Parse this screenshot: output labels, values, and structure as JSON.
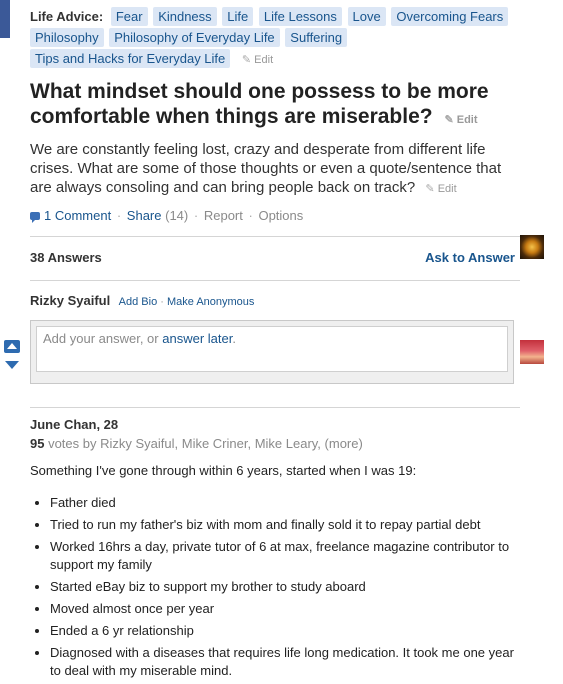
{
  "topics": {
    "label": "Life Advice:",
    "tags": [
      "Fear",
      "Kindness",
      "Life",
      "Life Lessons",
      "Love",
      "Overcoming Fears",
      "Philosophy",
      "Philosophy of Everyday Life",
      "Suffering",
      "Tips and Hacks for Everyday Life"
    ],
    "edit_label": "Edit"
  },
  "question": {
    "title": "What mindset should one possess to be more comfortable when things are miserable?",
    "edit_label": "Edit",
    "details": "We are constantly feeling lost, crazy and desperate from different life crises. What are some of those thoughts or even a quote/sentence that are always consoling and can bring people back on track?",
    "details_edit_label": "Edit"
  },
  "actions": {
    "comment": "1 Comment",
    "share": "Share",
    "share_count": "(14)",
    "report": "Report",
    "options": "Options",
    "separator": "·"
  },
  "answers_bar": {
    "count": "38 Answers",
    "ask": "Ask to Answer"
  },
  "composer": {
    "name": "Rizky Syaiful",
    "add_bio": "Add Bio",
    "make_anonymous": "Make Anonymous",
    "placeholder_prefix": "Add your answer, or ",
    "answer_later": "answer later",
    "placeholder_suffix": "."
  },
  "answer": {
    "author": "June Chan, 28",
    "votes_num": "95",
    "votes_text": " votes by Rizky Syaiful, Mike Criner, Mike Leary, (more)",
    "intro": "Something I've gone through within 6 years, started when I was 19:",
    "items": [
      "Father died",
      "Tried to run my father's biz with mom and finally sold it to repay partial debt",
      "Worked 16hrs a day, private tutor of 6 at max, freelance magazine contributor to support my family",
      "Started eBay biz to support my brother to study aboard",
      "Moved almost once per year",
      "Ended a 6 yr relationship",
      "Diagnosed with a diseases that requires life long medication. It took me one year to deal with my miserable mind."
    ]
  },
  "colors": {
    "link": "#19558d",
    "tag_bg": "#dbe6f5",
    "vote": "#2e6bb0"
  },
  "icons": {
    "comment": "speech-bubble-icon",
    "edit": "pencil-icon",
    "upvote": "upvote-arrow-icon",
    "downvote": "downvote-arrow-icon"
  }
}
